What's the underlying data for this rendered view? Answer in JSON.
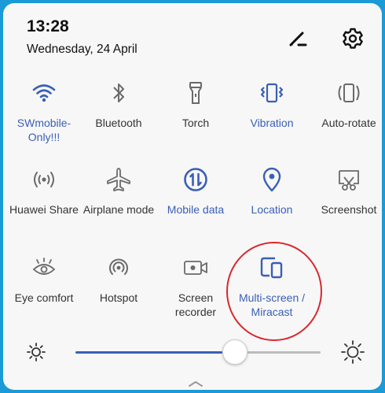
{
  "header": {
    "time": "13:28",
    "date": "Wednesday, 24 April"
  },
  "colors": {
    "active": "#3a5fb5",
    "inactive": "#6a6a6a",
    "highlight_ring": "#d9272e",
    "slider_track": "#3a5fb5"
  },
  "tiles": [
    {
      "label": "SWmobile-\nOnly!!!",
      "icon": "wifi-icon",
      "active": true
    },
    {
      "label": "Bluetooth",
      "icon": "bluetooth-icon",
      "active": false
    },
    {
      "label": "Torch",
      "icon": "torch-icon",
      "active": false
    },
    {
      "label": "Vibration",
      "icon": "vibration-icon",
      "active": true
    },
    {
      "label": "Auto-rotate",
      "icon": "auto-rotate-icon",
      "active": false
    },
    {
      "label": "Huawei Share",
      "icon": "huawei-share-icon",
      "active": false
    },
    {
      "label": "Airplane mode",
      "icon": "airplane-icon",
      "active": false
    },
    {
      "label": "Mobile data",
      "icon": "mobile-data-icon",
      "active": true
    },
    {
      "label": "Location",
      "icon": "location-icon",
      "active": true
    },
    {
      "label": "Screenshot",
      "icon": "screenshot-icon",
      "active": false
    },
    {
      "label": "Eye comfort",
      "icon": "eye-comfort-icon",
      "active": false
    },
    {
      "label": "Hotspot",
      "icon": "hotspot-icon",
      "active": false
    },
    {
      "label": "Screen\nrecorder",
      "icon": "screen-recorder-icon",
      "active": false
    },
    {
      "label": "Multi-screen /\nMiracast",
      "icon": "multi-screen-icon",
      "active": true
    }
  ],
  "brightness": {
    "level": 0.65
  }
}
